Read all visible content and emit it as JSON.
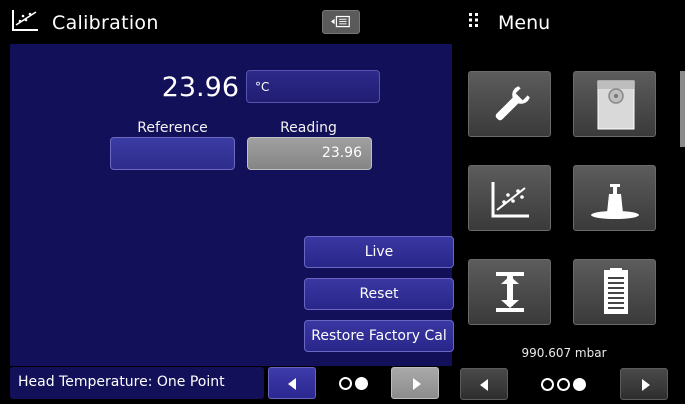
{
  "header": {
    "calibration_title": "Calibration",
    "menu_title": "Menu"
  },
  "reading": {
    "value": "23.96",
    "unit": "°C",
    "reference_label": "Reference",
    "reading_label": "Reading",
    "reference_value": "",
    "reading_value": "23.96"
  },
  "actions": {
    "live": "Live",
    "reset": "Reset",
    "restore": "Restore Factory Cal"
  },
  "status": {
    "text": "Head Temperature: One Point",
    "page_dots": [
      false,
      true
    ]
  },
  "menu": {
    "tiles": [
      {
        "icon": "wrench-icon",
        "label": "settings"
      },
      {
        "icon": "storage-icon",
        "label": "storage"
      },
      {
        "icon": "calibration-chart-icon",
        "label": "calibration"
      },
      {
        "icon": "weight-icon",
        "label": "tare"
      },
      {
        "icon": "head-height-icon",
        "label": "head"
      },
      {
        "icon": "clipboard-icon",
        "label": "info"
      }
    ],
    "barometer": "990.607 mbar",
    "page_dots": [
      false,
      false,
      true
    ]
  }
}
